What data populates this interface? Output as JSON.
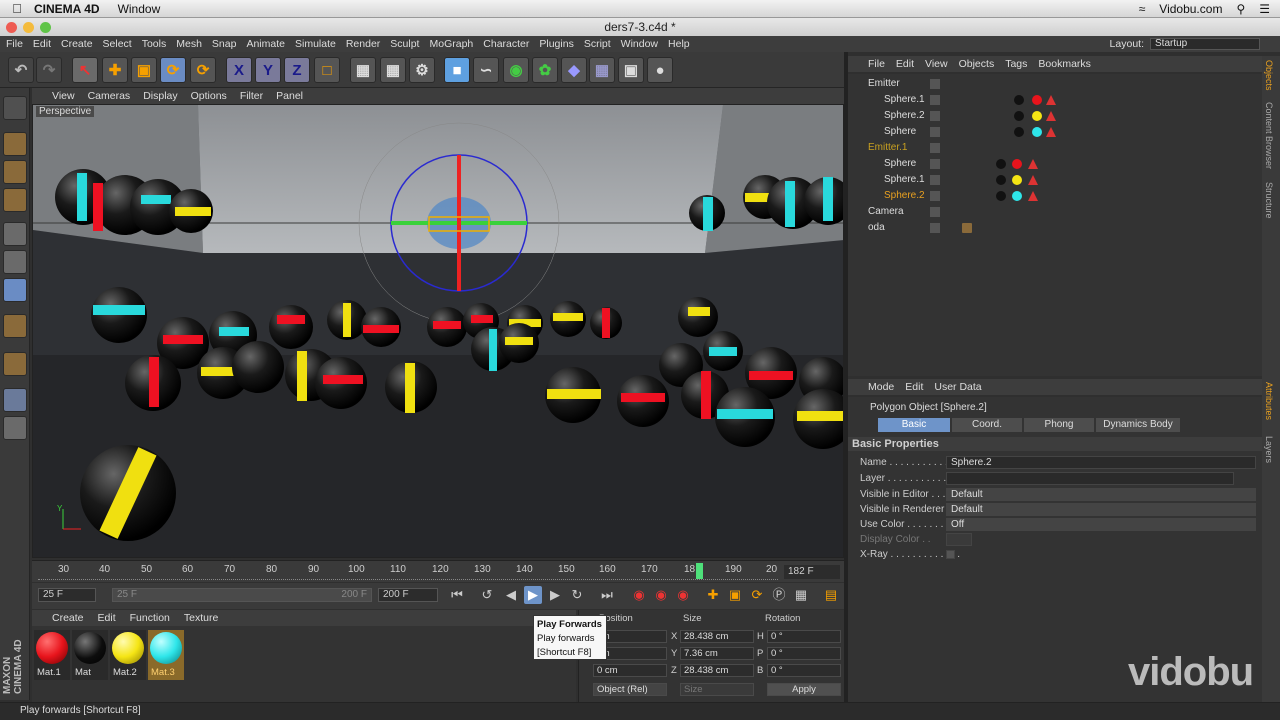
{
  "mac_menu": {
    "app": "CINEMA 4D",
    "window": "Window",
    "site": "Vidobu.com"
  },
  "window_title": "ders7-3.c4d *",
  "app_menu": [
    "File",
    "Edit",
    "Create",
    "Select",
    "Tools",
    "Mesh",
    "Snap",
    "Animate",
    "Simulate",
    "Render",
    "Sculpt",
    "MoGraph",
    "Character",
    "Plugins",
    "Script",
    "Window",
    "Help"
  ],
  "layout": {
    "label": "Layout:",
    "value": "Startup"
  },
  "viewport": {
    "menu": [
      "View",
      "Cameras",
      "Display",
      "Options",
      "Filter",
      "Panel"
    ],
    "label": "Perspective"
  },
  "timeline": {
    "ticks": [
      "30",
      "40",
      "50",
      "60",
      "70",
      "80",
      "90",
      "100",
      "110",
      "120",
      "130",
      "140",
      "150",
      "160",
      "170",
      "18",
      "190",
      "20"
    ],
    "current_frame": "182 F",
    "start": "25 F",
    "range_start": "25 F",
    "range_end": "200 F",
    "end": "200 F"
  },
  "materials": {
    "menu": [
      "Create",
      "Edit",
      "Function",
      "Texture"
    ],
    "items": [
      {
        "name": "Mat.1",
        "color": "#e8141c"
      },
      {
        "name": "Mat",
        "color": "#0d0d0d"
      },
      {
        "name": "Mat.2",
        "color": "#f5e514"
      },
      {
        "name": "Mat.3",
        "color": "#2ee6ea"
      }
    ]
  },
  "coords": {
    "headers": [
      "Position",
      "Size",
      "Rotation"
    ],
    "pos": [
      "cm",
      "cm",
      "0 cm"
    ],
    "size_labels": [
      "X",
      "Y",
      "Z"
    ],
    "size": [
      "28.438 cm",
      "7.36 cm",
      "28.438 cm"
    ],
    "rot_labels": [
      "H",
      "P",
      "B"
    ],
    "rot": [
      "0 °",
      "0 °",
      "0 °"
    ],
    "mode": "Object (Rel)",
    "size_mode": "Size",
    "apply": "Apply"
  },
  "tooltip": {
    "title": "Play Forwards",
    "line1": "Play forwards",
    "line2": "[Shortcut F8]"
  },
  "status": "Play forwards [Shortcut F8]",
  "objects_panel": {
    "menu": [
      "File",
      "Edit",
      "View",
      "Objects",
      "Tags",
      "Bookmarks"
    ],
    "rows": [
      {
        "name": "Emitter",
        "indent": 0,
        "color": "#ddd"
      },
      {
        "name": "Sphere.1",
        "indent": 1,
        "color": "#ddd"
      },
      {
        "name": "Sphere.2",
        "indent": 1,
        "color": "#ddd"
      },
      {
        "name": "Sphere",
        "indent": 1,
        "color": "#ddd"
      },
      {
        "name": "Emitter.1",
        "indent": 0,
        "color": "#c8a020"
      },
      {
        "name": "Sphere",
        "indent": 1,
        "color": "#ddd"
      },
      {
        "name": "Sphere.1",
        "indent": 1,
        "color": "#ddd"
      },
      {
        "name": "Sphere.2",
        "indent": 1,
        "color": "#e8a020"
      },
      {
        "name": "Camera",
        "indent": 0,
        "color": "#ddd"
      },
      {
        "name": "oda",
        "indent": 0,
        "color": "#ddd"
      }
    ]
  },
  "attributes": {
    "menu": [
      "Mode",
      "Edit",
      "User Data"
    ],
    "object_title": "Polygon Object [Sphere.2]",
    "tabs": [
      "Basic",
      "Coord.",
      "Phong",
      "Dynamics Body"
    ],
    "section": "Basic Properties",
    "rows": [
      {
        "label": "Name . . . . . . . . . . . . .",
        "value": "Sphere.2"
      },
      {
        "label": "Layer . . . . . . . . . . . . .",
        "value": ""
      },
      {
        "label": "Visible in Editor . . .",
        "value": "Default"
      },
      {
        "label": "Visible in Renderer",
        "value": "Default"
      },
      {
        "label": "Use Color . . . . . . . . .",
        "value": "Off"
      },
      {
        "label": "Display Color . .",
        "value": ""
      },
      {
        "label": "X-Ray . . . . . . . . . . . . .",
        "value": ""
      }
    ]
  },
  "side_tabs": [
    "Objects",
    "Content Browser",
    "Structure",
    "Attributes",
    "Layers"
  ],
  "side_left": [
    "MAXON",
    "CINEMA 4D"
  ],
  "watermark": "vidobu"
}
